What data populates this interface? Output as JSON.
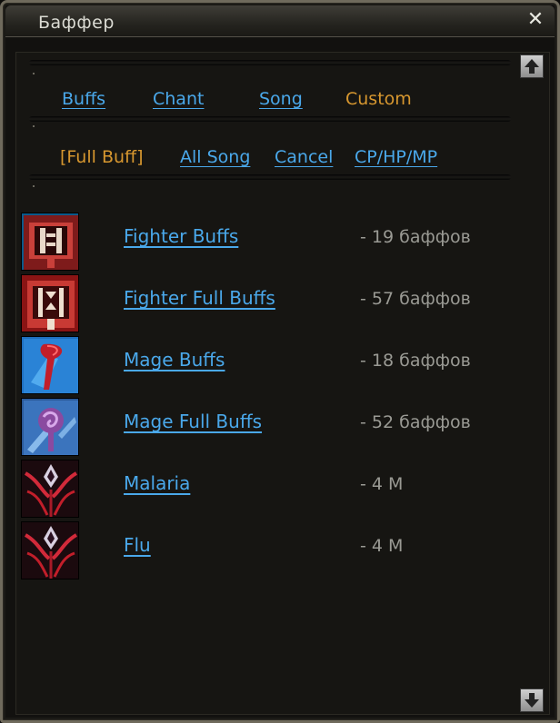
{
  "window": {
    "title": "Баффер"
  },
  "tabs_primary": [
    {
      "label": "Buffs",
      "active": false
    },
    {
      "label": "Chant",
      "active": false
    },
    {
      "label": "Song",
      "active": false
    },
    {
      "label": "Custom",
      "active": true
    }
  ],
  "tabs_secondary": [
    {
      "label": "[Full Buff]",
      "active": true
    },
    {
      "label": "All Song",
      "active": false
    },
    {
      "label": "Cancel",
      "active": false
    },
    {
      "label": "CP/HP/MP",
      "active": false
    }
  ],
  "rows": [
    {
      "label": "Fighter Buffs",
      "count": "- 19 баффов",
      "icon": "fighter-buff-icon"
    },
    {
      "label": "Fighter Full Buffs",
      "count": "- 57 баффов",
      "icon": "fighter-full-buff-icon"
    },
    {
      "label": "Mage Buffs",
      "count": "- 18 баффов",
      "icon": "mage-buff-icon"
    },
    {
      "label": "Mage Full Buffs",
      "count": "- 52 баффов",
      "icon": "mage-full-buff-icon"
    },
    {
      "label": "Malaria",
      "count": "- 4 M",
      "icon": "malaria-icon"
    },
    {
      "label": "Flu",
      "count": "- 4 M",
      "icon": "flu-icon"
    }
  ],
  "colors": {
    "link": "#4aa8ea",
    "active": "#d7972f",
    "muted": "#9a9a94"
  }
}
